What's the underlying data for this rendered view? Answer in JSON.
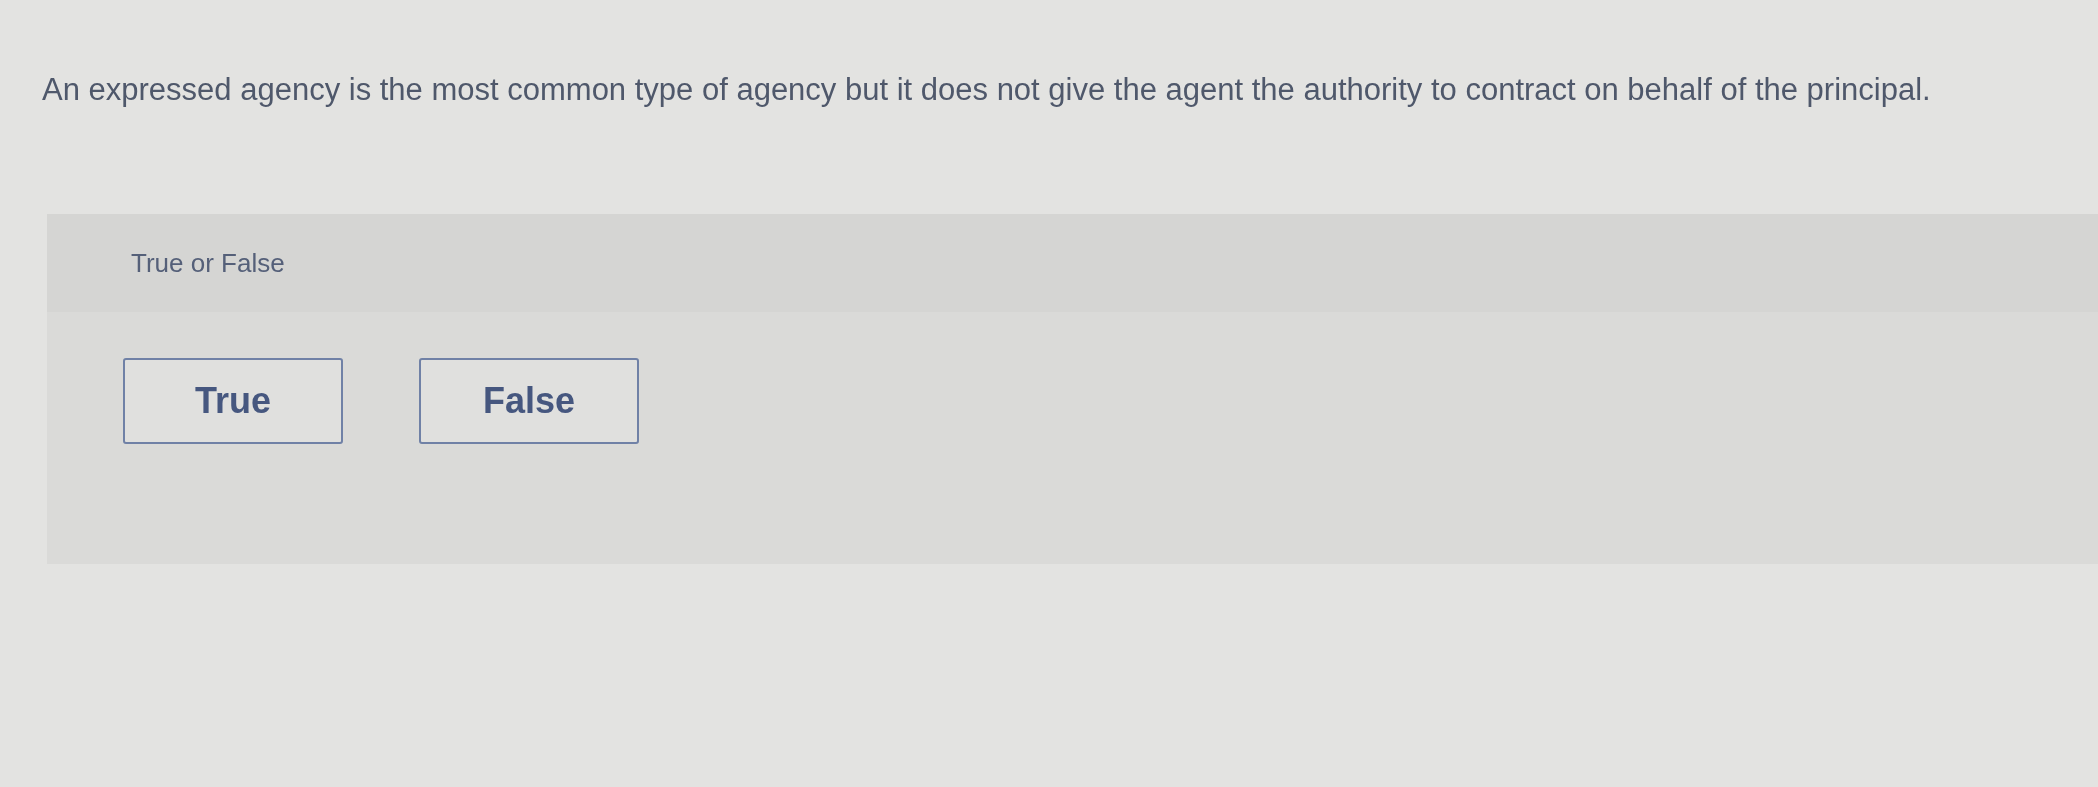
{
  "question": {
    "text": "An expressed agency is the most common type of agency but it does not give the agent the authority to contract on behalf of the principal."
  },
  "prompt": {
    "label": "True or False"
  },
  "options": [
    {
      "label": "True",
      "selected": false
    },
    {
      "label": "False",
      "selected": false
    }
  ]
}
